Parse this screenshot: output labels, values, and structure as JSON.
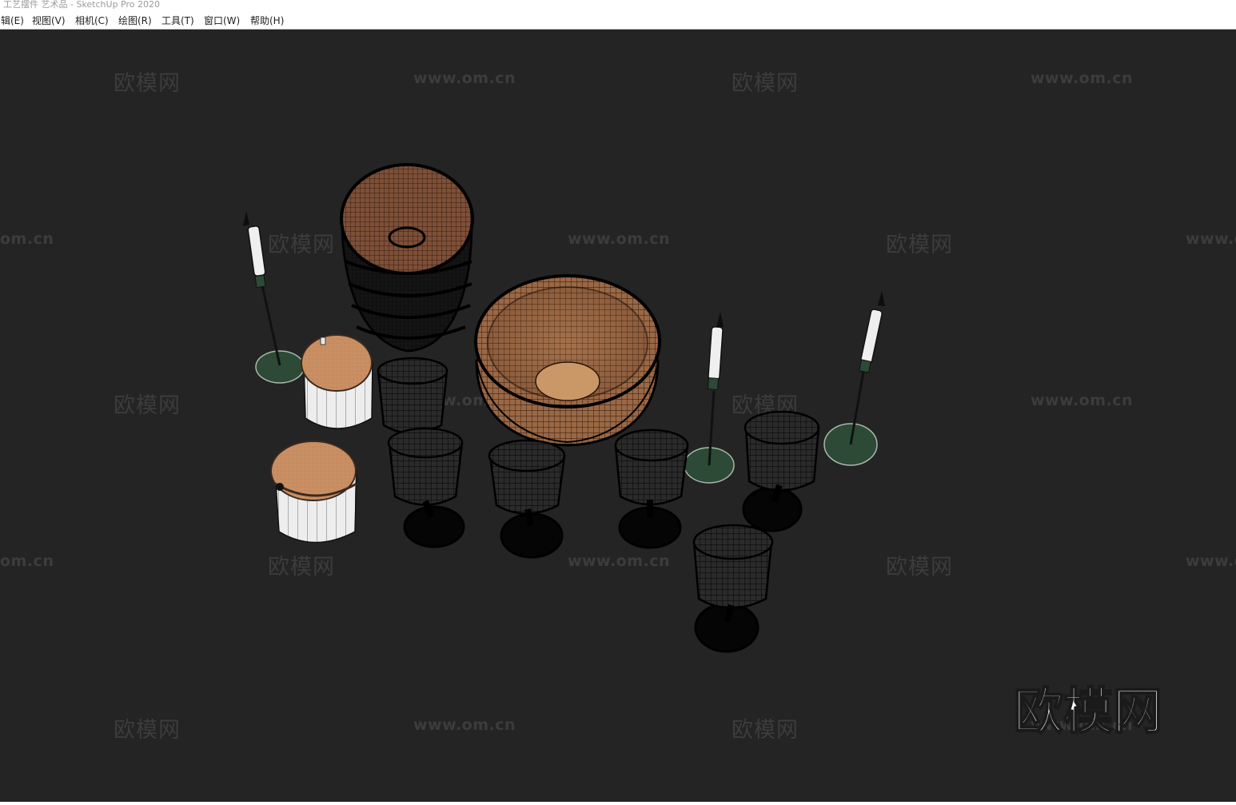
{
  "window": {
    "title": "工艺摆件 艺术品 - SketchUp Pro 2020"
  },
  "menubar": {
    "items": [
      {
        "label": "辑(E)"
      },
      {
        "label": "视图(V)"
      },
      {
        "label": "相机(C)"
      },
      {
        "label": "绘图(R)"
      },
      {
        "label": "工具(T)"
      },
      {
        "label": "窗口(W)"
      },
      {
        "label": "帮助(H)"
      }
    ]
  },
  "watermarks": {
    "brand_text": "欧模网",
    "url_text": "www.om.cn",
    "url_partial": "om.cn",
    "url_partial_right": "www.o",
    "big_logo_text": "欧模网"
  },
  "viewport": {
    "background_color": "#242424",
    "objects": [
      "stacked-bowls",
      "woven-bowl",
      "candle-stand",
      "candle-stand",
      "candle-stand",
      "lidded-jar",
      "lidded-jar",
      "wireframe-glass",
      "wireframe-glass",
      "wireframe-glass",
      "wireframe-glass",
      "wireframe-glass",
      "wireframe-glass"
    ]
  },
  "colors": {
    "cork": "#c98f63",
    "jar_white": "#ececec",
    "base_green": "#2c4a36",
    "bowl_brown": "#8a5a3e",
    "stacked_bowl": "#3e2e26"
  }
}
